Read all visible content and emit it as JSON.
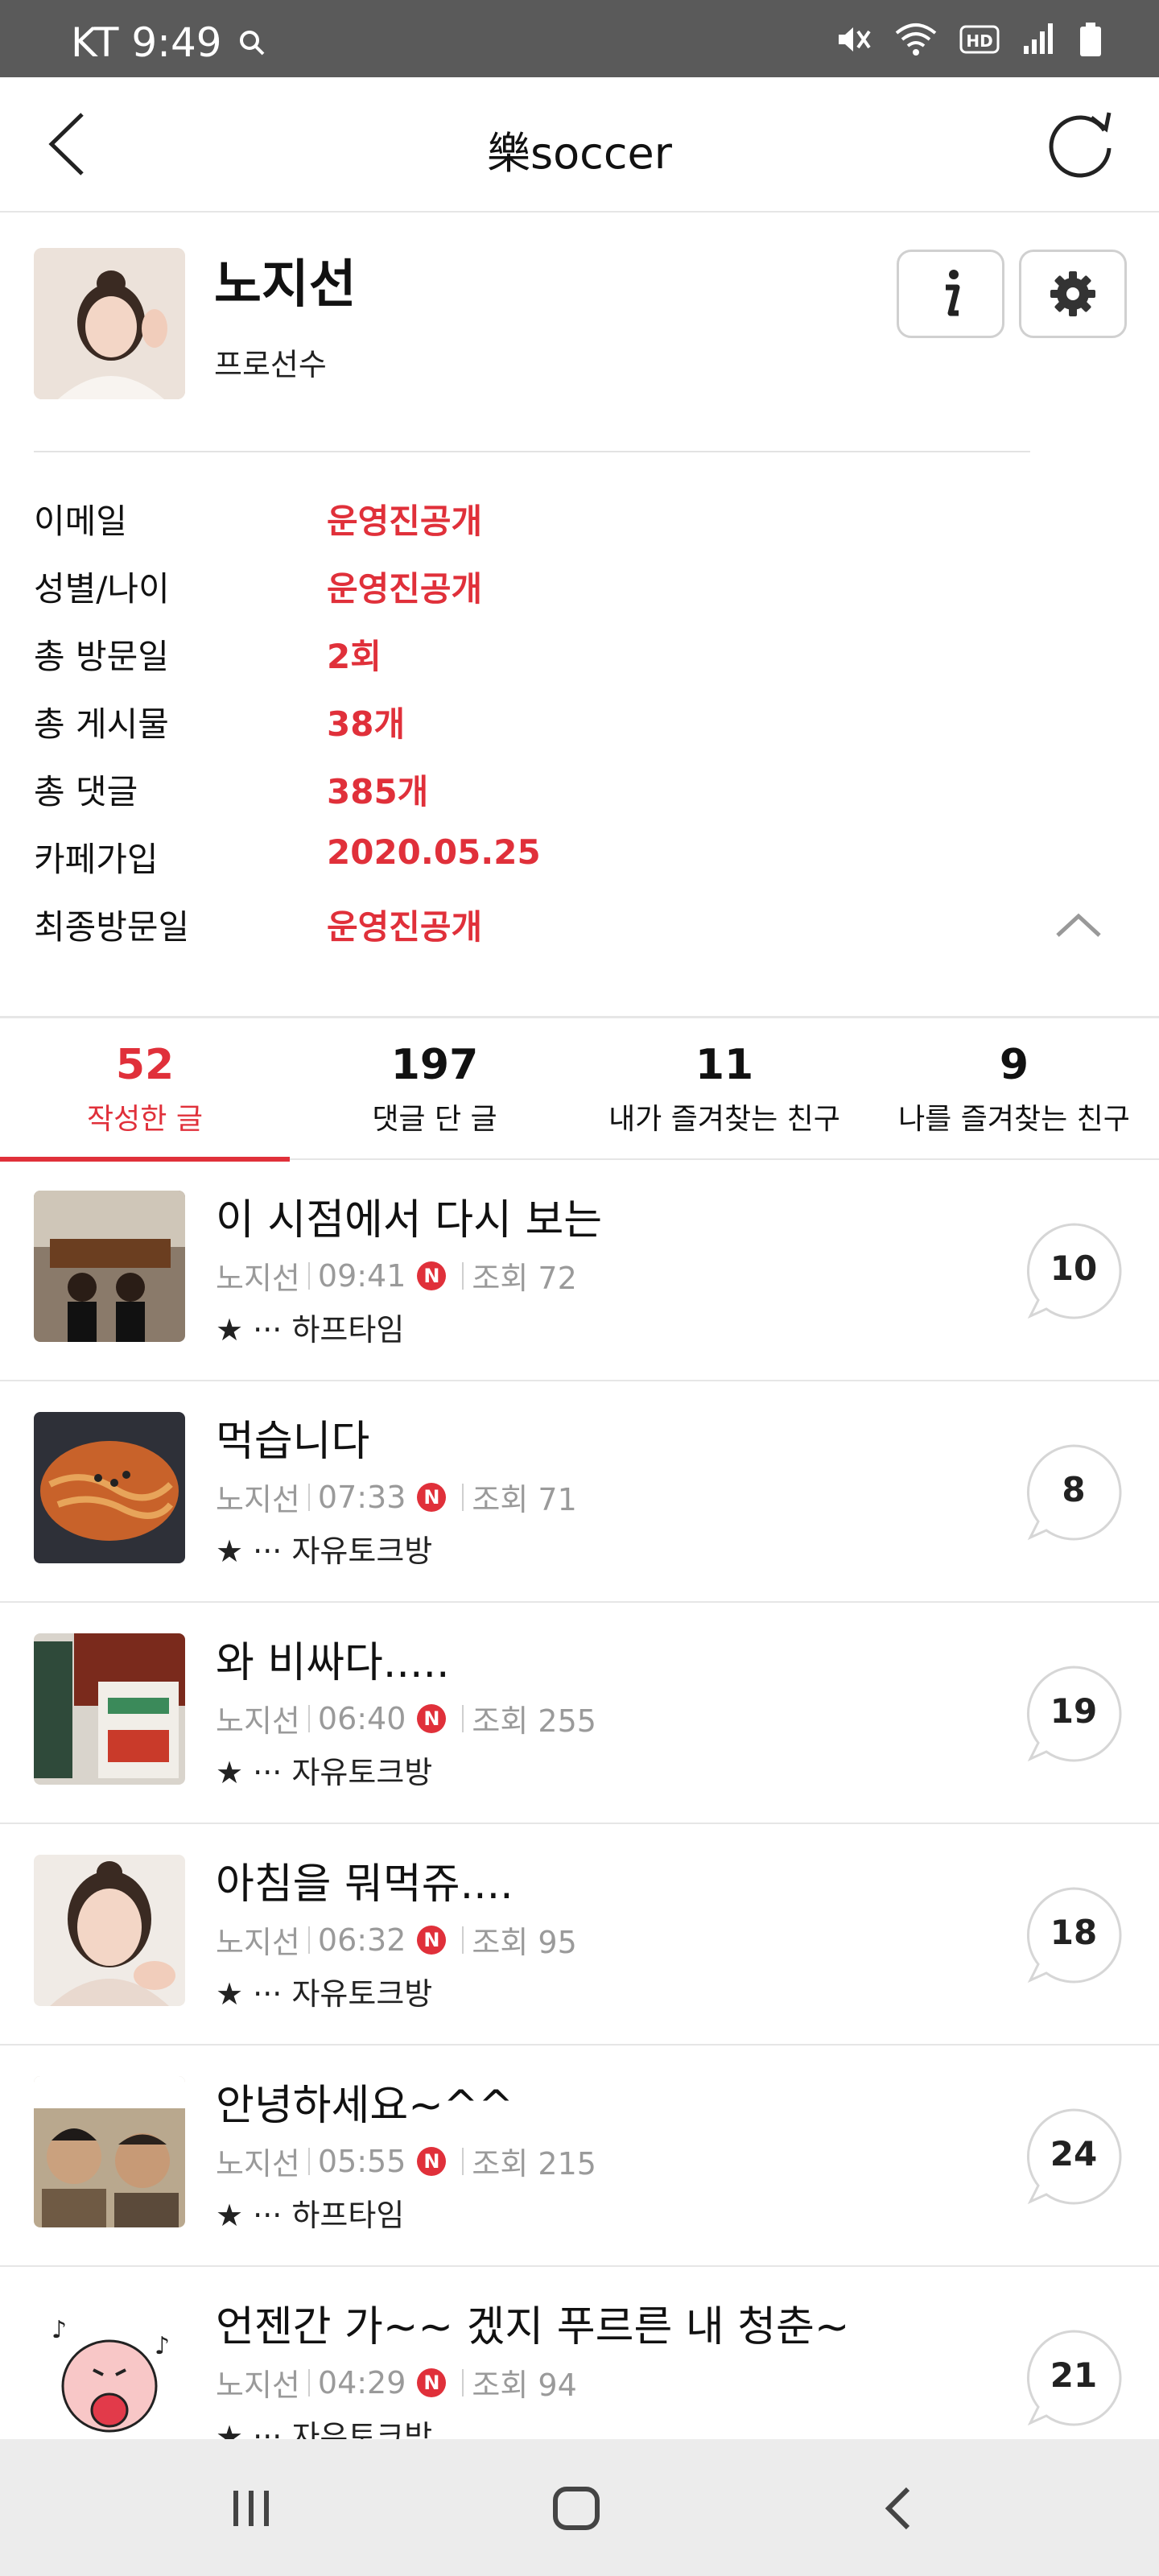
{
  "status_bar": {
    "carrier_time": "KT 9:49"
  },
  "header": {
    "title": "樂soccer"
  },
  "profile": {
    "name": "노지선",
    "role": "프로선수"
  },
  "info": [
    {
      "key": "이메일",
      "value": "운영진공개"
    },
    {
      "key": "성별/나이",
      "value": "운영진공개"
    },
    {
      "key": "총 방문일",
      "value": "2회"
    },
    {
      "key": "총 게시물",
      "value": "38개"
    },
    {
      "key": "총 댓글",
      "value": "385개"
    },
    {
      "key": "카페가입",
      "value": "2020.05.25"
    },
    {
      "key": "최종방문일",
      "value": "운영진공개"
    }
  ],
  "tabs": [
    {
      "count": "52",
      "label": "작성한 글"
    },
    {
      "count": "197",
      "label": "댓글 단 글"
    },
    {
      "count": "11",
      "label": "내가 즐겨찾는 친구"
    },
    {
      "count": "9",
      "label": "나를 즐겨찾는 친구"
    }
  ],
  "posts": [
    {
      "title": "이 시점에서 다시 보는",
      "author": "노지선",
      "time": "09:41",
      "new_badge": "N",
      "views": "조회 72",
      "board": "★ ··· 하프타임",
      "comments": "10"
    },
    {
      "title": "먹습니다",
      "author": "노지선",
      "time": "07:33",
      "new_badge": "N",
      "views": "조회 71",
      "board": "★ ··· 자유토크방",
      "comments": "8"
    },
    {
      "title": "와 비싸다.....",
      "author": "노지선",
      "time": "06:40",
      "new_badge": "N",
      "views": "조회 255",
      "board": "★ ··· 자유토크방",
      "comments": "19"
    },
    {
      "title": "아침을 뭐먹쥬....",
      "author": "노지선",
      "time": "06:32",
      "new_badge": "N",
      "views": "조회 95",
      "board": "★ ··· 자유토크방",
      "comments": "18"
    },
    {
      "title": "안녕하세요~^^",
      "author": "노지선",
      "time": "05:55",
      "new_badge": "N",
      "views": "조회 215",
      "board": "★ ··· 하프타임",
      "comments": "24"
    },
    {
      "title": "언젠간 가~~ 겠지 푸르른 내 청춘~",
      "author": "노지선",
      "time": "04:29",
      "new_badge": "N",
      "views": "조회 94",
      "board": "★ ··· 자유토크방",
      "comments": "21"
    }
  ],
  "colors": {
    "accent": "#e0303a",
    "status_bar": "#5a5a5a",
    "nav_bar": "#ececec"
  }
}
